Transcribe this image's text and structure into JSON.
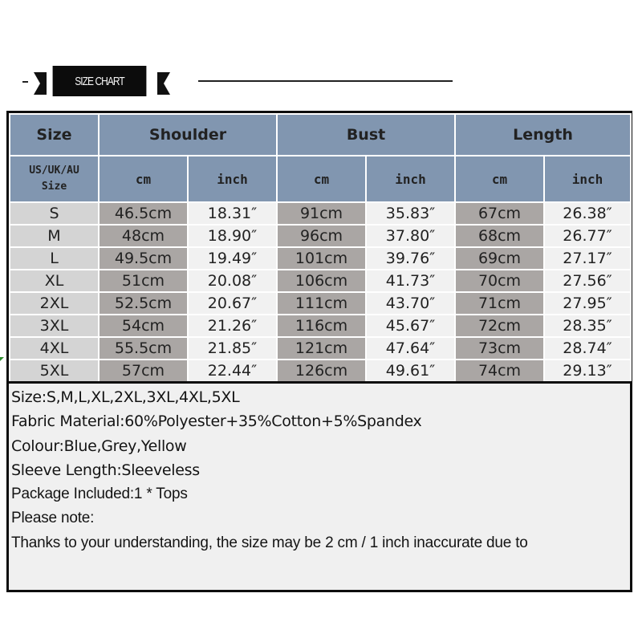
{
  "banner": {
    "title": "SIZE CHART"
  },
  "table": {
    "header_groups": [
      {
        "label": "Size"
      },
      {
        "label": "Shoulder"
      },
      {
        "label": "Bust"
      },
      {
        "label": "Length"
      }
    ],
    "subheaders": {
      "size_label_line1": "US/UK/AU",
      "size_label_line2": "Size",
      "units": [
        "cm",
        "inch",
        "cm",
        "inch",
        "cm",
        "inch"
      ]
    },
    "rows": [
      {
        "size": "S",
        "shoulder_cm": "46.5cm",
        "shoulder_in": "18.31″",
        "bust_cm": "91cm",
        "bust_in": "35.83″",
        "length_cm": "67cm",
        "length_in": "26.38″"
      },
      {
        "size": "M",
        "shoulder_cm": "48cm",
        "shoulder_in": "18.90″",
        "bust_cm": "96cm",
        "bust_in": "37.80″",
        "length_cm": "68cm",
        "length_in": "26.77″"
      },
      {
        "size": "L",
        "shoulder_cm": "49.5cm",
        "shoulder_in": "19.49″",
        "bust_cm": "101cm",
        "bust_in": "39.76″",
        "length_cm": "69cm",
        "length_in": "27.17″"
      },
      {
        "size": "XL",
        "shoulder_cm": "51cm",
        "shoulder_in": "20.08″",
        "bust_cm": "106cm",
        "bust_in": "41.73″",
        "length_cm": "70cm",
        "length_in": "27.56″"
      },
      {
        "size": "2XL",
        "shoulder_cm": "52.5cm",
        "shoulder_in": "20.67″",
        "bust_cm": "111cm",
        "bust_in": "43.70″",
        "length_cm": "71cm",
        "length_in": "27.95″"
      },
      {
        "size": "3XL",
        "shoulder_cm": "54cm",
        "shoulder_in": "21.26″",
        "bust_cm": "116cm",
        "bust_in": "45.67″",
        "length_cm": "72cm",
        "length_in": "28.35″"
      },
      {
        "size": "4XL",
        "shoulder_cm": "55.5cm",
        "shoulder_in": "21.85″",
        "bust_cm": "121cm",
        "bust_in": "47.64″",
        "length_cm": "73cm",
        "length_in": "28.74″"
      },
      {
        "size": "5XL",
        "shoulder_cm": "57cm",
        "shoulder_in": "22.44″",
        "bust_cm": "126cm",
        "bust_in": "49.61″",
        "length_cm": "74cm",
        "length_in": "29.13″"
      }
    ]
  },
  "notes": {
    "lines": [
      "Size:S,M,L,XL,2XL,3XL,4XL,5XL",
      "Fabric Material:60%Polyester+35%Cotton+5%Spandex",
      "Colour:Blue,Grey,Yellow",
      "Sleeve Length:Sleeveless",
      "Package Included:1 * Tops",
      "Please note:",
      "Thanks to your understanding, the size may be 2 cm / 1 inch inaccurate due to"
    ]
  },
  "colors": {
    "header_bg": "#8196b0",
    "size_col_bg": "#d4d4d4",
    "cm_col_bg": "#aaa6a4",
    "inch_col_bg": "#f1f1f1",
    "notes_bg": "#f0f0f0"
  }
}
